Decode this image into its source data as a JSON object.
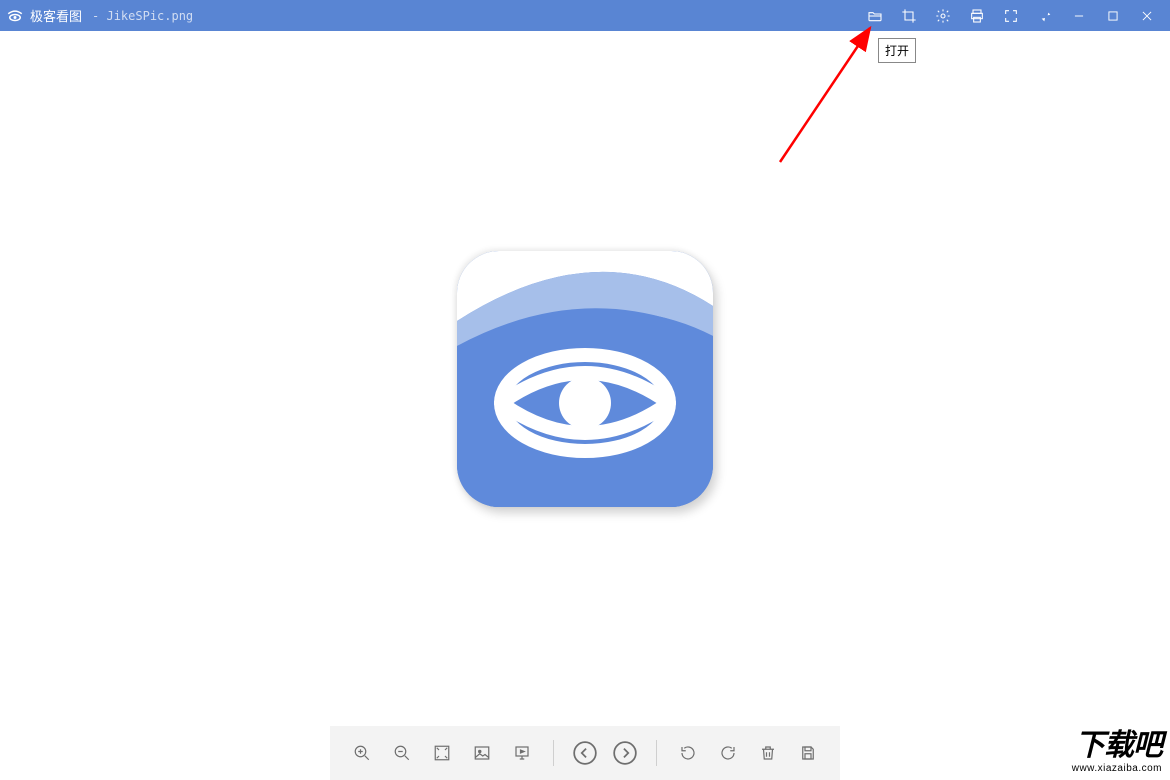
{
  "titlebar": {
    "app_name": "极客看图",
    "filename": "- JikeSPic.png",
    "actions": {
      "open": "folder-open-icon",
      "crop": "crop-icon",
      "settings": "gear-icon",
      "print": "print-icon",
      "fullscreen": "fullscreen-icon",
      "pin": "pin-icon",
      "minimize": "minimize-icon",
      "maximize": "maximize-icon",
      "close": "close-icon"
    }
  },
  "tooltip": {
    "open": "打开"
  },
  "bottombar": {
    "actions": {
      "zoom_in": "zoom-in-icon",
      "zoom_out": "zoom-out-icon",
      "fit": "fit-screen-icon",
      "thumbnail": "image-icon",
      "slideshow": "slideshow-icon",
      "prev": "prev-icon",
      "next": "next-icon",
      "rotate_ccw": "rotate-ccw-icon",
      "rotate_cw": "rotate-cw-icon",
      "delete": "trash-icon",
      "save": "save-icon"
    }
  },
  "watermark": {
    "big": "下载吧",
    "small": "www.xiazaiba.com"
  }
}
